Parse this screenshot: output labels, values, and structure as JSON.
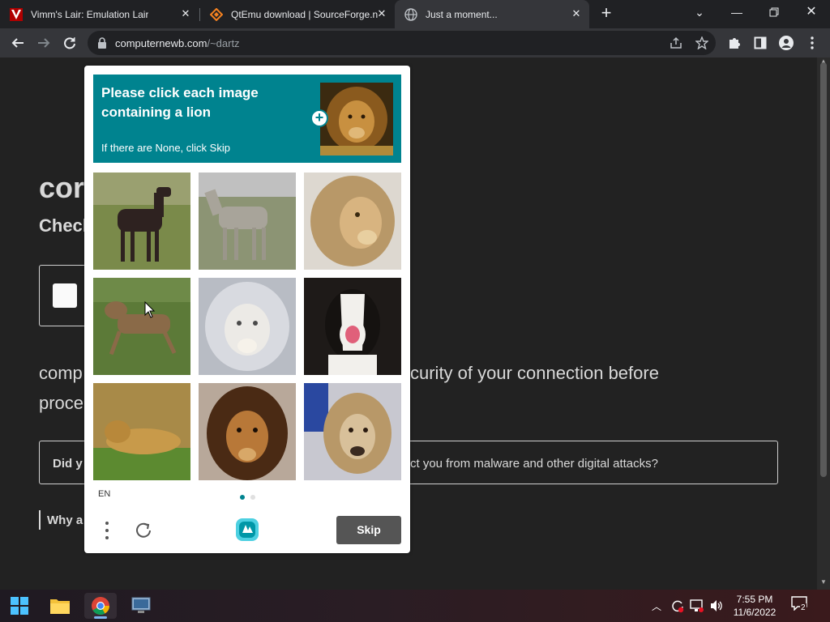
{
  "browser": {
    "tabs": [
      {
        "title": "Vimm's Lair: Emulation Lair",
        "favicon": "vimm-v-icon"
      },
      {
        "title": "QtEmu download | SourceForge.n",
        "favicon": "sourceforge-icon"
      },
      {
        "title": "Just a moment...",
        "favicon": "globe-icon"
      }
    ],
    "url_host": "computernewb.com",
    "url_path": "/~dartz"
  },
  "page": {
    "heading_fragment": "cor",
    "subheading_fragment": "Check",
    "body_left": "comp",
    "body_left2": "proce",
    "body_right": "curity of your connection before",
    "notice_left": "Did y",
    "notice_right": "ct you from malware and other digital attacks?",
    "why_fragment": "Why a"
  },
  "captcha": {
    "prompt": "Please click each image containing a lion",
    "instruction": "If there are None, click Skip",
    "example": "lion",
    "images": [
      {
        "label": "dark horse"
      },
      {
        "label": "gray horse"
      },
      {
        "label": "lion"
      },
      {
        "label": "running dog"
      },
      {
        "label": "white lion"
      },
      {
        "label": "black and white dog"
      },
      {
        "label": "lying lion"
      },
      {
        "label": "lion"
      },
      {
        "label": "collie dog"
      }
    ],
    "language": "EN",
    "skip_label": "Skip",
    "accent_color": "#00838f"
  },
  "taskbar": {
    "time": "7:55 PM",
    "date": "11/6/2022",
    "notifications": "2"
  }
}
